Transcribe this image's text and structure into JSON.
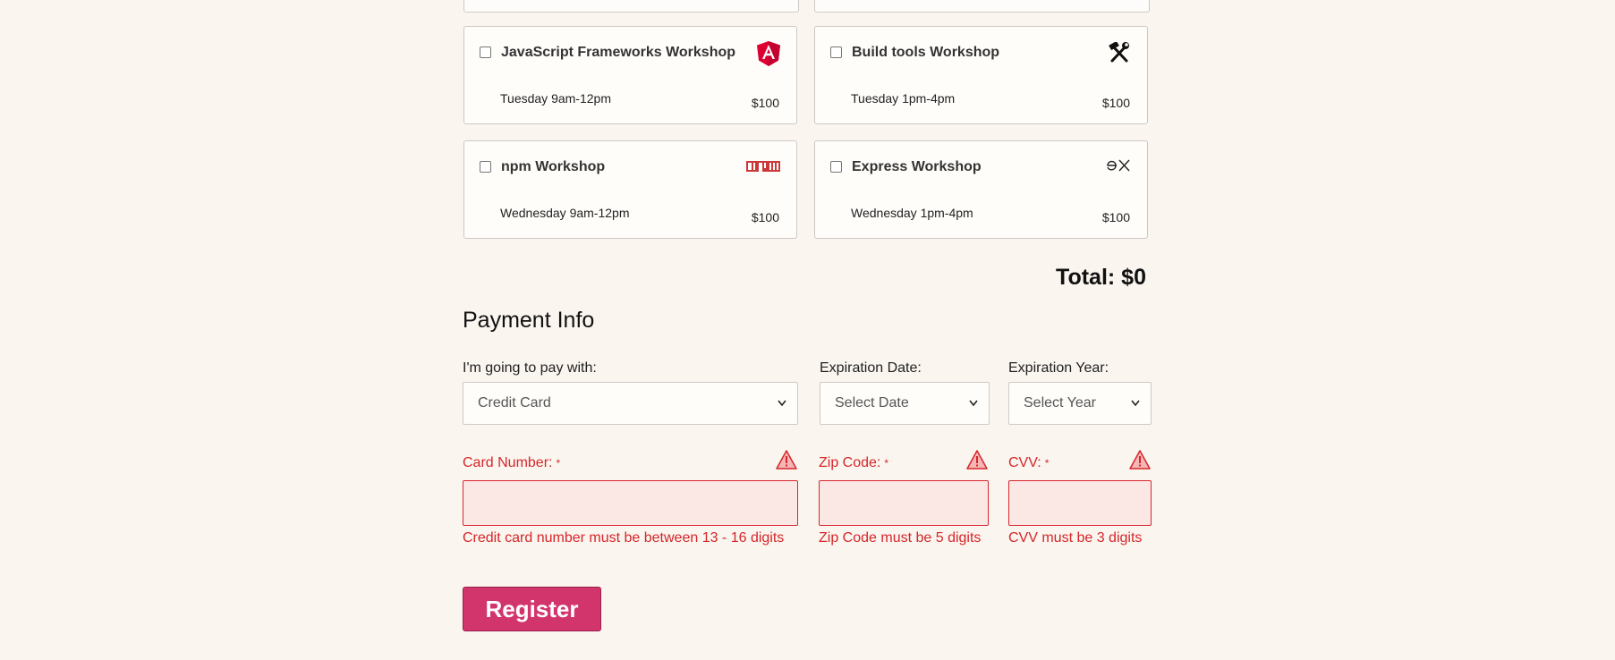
{
  "workshops": [
    {
      "name": "JavaScript Frameworks Workshop",
      "time": "Tuesday 9am-12pm",
      "cost": "$100",
      "icon": "angular-icon"
    },
    {
      "name": "Build tools Workshop",
      "time": "Tuesday 1pm-4pm",
      "cost": "$100",
      "icon": "hammer-wrench-icon"
    },
    {
      "name": "npm Workshop",
      "time": "Wednesday 9am-12pm",
      "cost": "$100",
      "icon": "npm-icon"
    },
    {
      "name": "Express Workshop",
      "time": "Wednesday 1pm-4pm",
      "cost": "$100",
      "icon": "express-icon"
    }
  ],
  "total_label": "Total: $0",
  "payment": {
    "title": "Payment Info",
    "method_label": "I'm going to pay with:",
    "method_value": "Credit Card",
    "exp_date_label": "Expiration Date:",
    "exp_date_value": "Select Date",
    "exp_year_label": "Expiration Year:",
    "exp_year_value": "Select Year",
    "card_label": "Card Number:",
    "zip_label": "Zip Code:",
    "cvv_label": "CVV:",
    "required_mark": "*",
    "card_error": "Credit card number must be between 13 - 16 digits",
    "zip_error": "Zip Code must be 5 digits",
    "cvv_error": "CVV must be 3 digits"
  },
  "register_label": "Register",
  "colors": {
    "error": "#d6262a",
    "register": "#d2346c",
    "angular": "#dd0031",
    "npm": "#cb3837"
  }
}
